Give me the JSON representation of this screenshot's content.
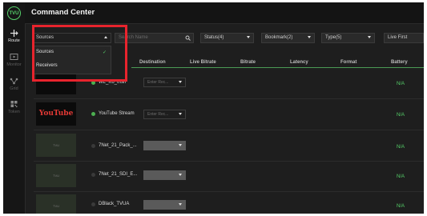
{
  "app": {
    "title": "Command Center",
    "logo_text": "TVU"
  },
  "rail": {
    "items": [
      {
        "label": "Route",
        "icon": "route-icon",
        "active": true
      },
      {
        "label": "Monitor",
        "icon": "monitor-icon"
      },
      {
        "label": "Grid",
        "icon": "grid-network-icon"
      },
      {
        "label": "Token",
        "icon": "qr-token-icon"
      }
    ]
  },
  "filters": {
    "sources_select": "Sources",
    "search_placeholder": "Search Name",
    "status": "Status(4)",
    "bookmarks": "Bookmark(2)",
    "type": "Type(5)",
    "sort": "Live First"
  },
  "dropdown": {
    "options": [
      "Sources",
      "Receivers"
    ],
    "selected": "Sources"
  },
  "table": {
    "headers": {
      "destination": "Destination",
      "live_bitrate": "Live Bitrate",
      "bitrate": "Bitrate",
      "latency": "Latency",
      "format": "Format",
      "battery": "Battery"
    },
    "rows": [
      {
        "name": "WL_K6_trish",
        "status_color": "#4caf50",
        "destination": "Enter Rec...",
        "battery": "N/A",
        "thumb": "dark"
      },
      {
        "name": "YouTube Stream",
        "status_color": "#4caf50",
        "destination": "Enter Rec...",
        "battery": "N/A",
        "thumb": "youtube",
        "thumb_text": "YouTube"
      },
      {
        "name": "7Net_21_Pack_...",
        "status_color": "#3a3a3a",
        "destination": "",
        "battery": "N/A",
        "thumb": "tvu",
        "thumb_text": "TVU"
      },
      {
        "name": "7Net_21_SDI_E...",
        "status_color": "#3a3a3a",
        "destination": "",
        "battery": "N/A",
        "thumb": "tvu",
        "thumb_text": "TVU"
      },
      {
        "name": "DBlack_TVUA",
        "status_color": "#3a3a3a",
        "destination": "",
        "battery": "N/A",
        "thumb": "tvu",
        "thumb_text": "TVU"
      }
    ]
  },
  "colors": {
    "accent": "#56d16a",
    "highlight": "#e8242d"
  }
}
